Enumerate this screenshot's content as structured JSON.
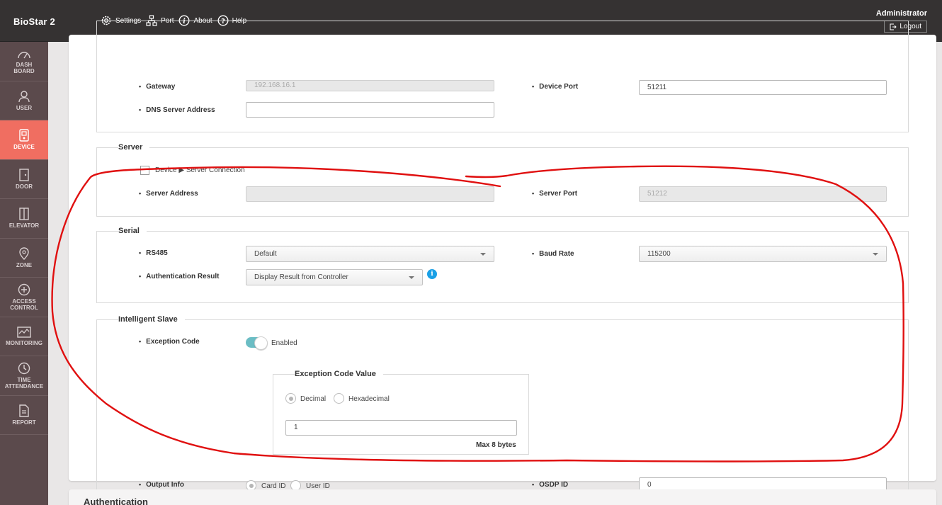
{
  "header": {
    "brand": "BioStar 2",
    "nav": [
      {
        "label": "Settings",
        "icon": "gear-icon"
      },
      {
        "label": "Port",
        "icon": "network-icon"
      },
      {
        "label": "About",
        "icon": "info-icon"
      },
      {
        "label": "Help",
        "icon": "help-icon"
      }
    ],
    "user": "Administrator",
    "logout_label": "Logout"
  },
  "sidebar": {
    "items": [
      {
        "label_line1": "DASH",
        "label_line2": "BOARD",
        "icon": "dashboard-icon"
      },
      {
        "label_line1": "USER",
        "label_line2": "",
        "icon": "user-icon"
      },
      {
        "label_line1": "DEVICE",
        "label_line2": "",
        "icon": "device-icon",
        "active": true
      },
      {
        "label_line1": "DOOR",
        "label_line2": "",
        "icon": "door-icon"
      },
      {
        "label_line1": "ELEVATOR",
        "label_line2": "",
        "icon": "elevator-icon"
      },
      {
        "label_line1": "ZONE",
        "label_line2": "",
        "icon": "zone-icon"
      },
      {
        "label_line1": "ACCESS",
        "label_line2": "CONTROL",
        "icon": "access-control-icon"
      },
      {
        "label_line1": "MONITORING",
        "label_line2": "",
        "icon": "monitoring-icon"
      },
      {
        "label_line1": "TIME",
        "label_line2": "ATTENDANCE",
        "icon": "clock-icon"
      },
      {
        "label_line1": "REPORT",
        "label_line2": "",
        "icon": "report-icon"
      }
    ]
  },
  "network": {
    "gateway_label": "Gateway",
    "gateway_value": "192.168.16.1",
    "dns_label": "DNS Server Address",
    "dns_value": "",
    "device_port_label": "Device Port",
    "device_port_value": "51211"
  },
  "server": {
    "legend": "Server",
    "connection_label": "Device ▶ Server Connection",
    "address_label": "Server Address",
    "address_value": "",
    "port_label": "Server Port",
    "port_value": "51212"
  },
  "serial": {
    "legend": "Serial",
    "rs485_label": "RS485",
    "rs485_value": "Default",
    "baud_label": "Baud Rate",
    "baud_value": "115200",
    "auth_label": "Authentication Result",
    "auth_value": "Display Result from Controller"
  },
  "intelligent_slave": {
    "legend": "Intelligent Slave",
    "exception_label": "Exception Code",
    "toggle_state": "Enabled",
    "ecv_legend": "Exception Code Value",
    "decimal_label": "Decimal",
    "hex_label": "Hexadecimal",
    "code_value": "1",
    "max_note": "Max 8 bytes",
    "output_label": "Output Info",
    "card_id_label": "Card ID",
    "user_id_label": "User ID",
    "osdp_label": "OSDP ID",
    "osdp_value": "0"
  },
  "authentication": {
    "title": "Authentication"
  },
  "colors": {
    "header_bg": "#353232",
    "sidebar_bg": "#5b4a4c",
    "active": "#f06e61",
    "toggle": "#6bbdc4",
    "annotation": "#e01010"
  }
}
